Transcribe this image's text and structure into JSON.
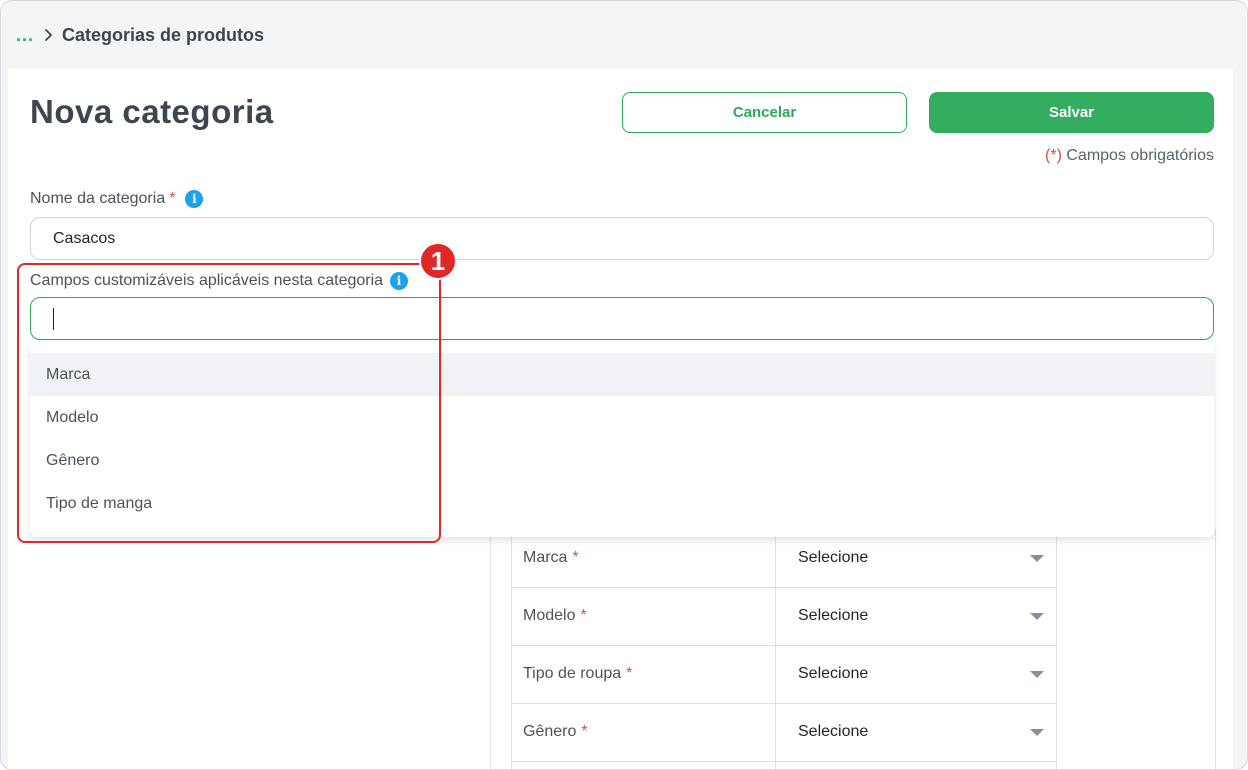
{
  "breadcrumb": {
    "ellipsis": "...",
    "current": "Categorias de produtos"
  },
  "page": {
    "title": "Nova categoria"
  },
  "actions": {
    "cancel": "Cancelar",
    "save": "Salvar"
  },
  "required_note": {
    "star": "(*)",
    "text": " Campos obrigatórios"
  },
  "form": {
    "name_label": "Nome da categoria",
    "name_value": "Casacos",
    "custom_fields_label": "Campos customizáveis aplicáveis nesta categoria",
    "required_mark": "*",
    "info_icon": "i"
  },
  "dropdown": {
    "options": [
      "Marca",
      "Modelo",
      "Gênero",
      "Tipo de manga"
    ],
    "highlighted_index": 0
  },
  "annotation": {
    "badge": "1"
  },
  "table": {
    "rows": [
      {
        "label": "Marca",
        "value": "Selecione"
      },
      {
        "label": "Modelo",
        "value": "Selecione"
      },
      {
        "label": "Tipo de roupa",
        "value": "Selecione"
      },
      {
        "label": "Gênero",
        "value": "Selecione"
      }
    ]
  },
  "colors": {
    "accent": "#34ad60",
    "required": "#e04b4b",
    "info": "#1aa3e8",
    "annotation": "#e02828"
  }
}
